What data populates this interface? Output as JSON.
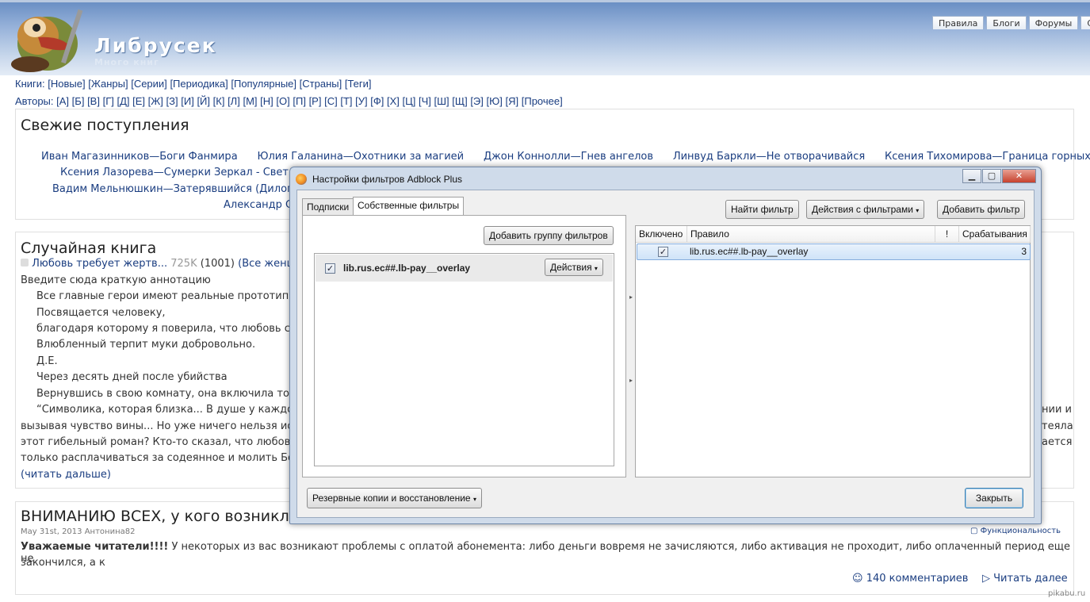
{
  "site": {
    "title": "Либрусек",
    "subtitle": "Много книг",
    "top_tabs": [
      "Правила",
      "Блоги",
      "Форумы",
      "С"
    ]
  },
  "nav": {
    "books_label": "Книги:",
    "books_links": [
      "[Новые]",
      "[Жанры]",
      "[Серии]",
      "[Периодика]",
      "[Популярные]",
      "[Страны]",
      "[Теги]"
    ],
    "authors_label": "Авторы:",
    "authors_links": [
      "[А]",
      "[Б]",
      "[В]",
      "[Г]",
      "[Д]",
      "[Е]",
      "[Ж]",
      "[З]",
      "[И]",
      "[Й]",
      "[К]",
      "[Л]",
      "[М]",
      "[Н]",
      "[О]",
      "[П]",
      "[Р]",
      "[С]",
      "[Т]",
      "[У]",
      "[Ф]",
      "[Х]",
      "[Ц]",
      "[Ч]",
      "[Ш]",
      "[Щ]",
      "[Э]",
      "[Ю]",
      "[Я]",
      "[Прочее]"
    ]
  },
  "fresh": {
    "title": "Свежие поступления",
    "row1": [
      "Иван Магазинников—Боги Фанмира",
      "Юлия Галанина—Охотники за магией",
      "Джон Коннолли—Гнев ангелов",
      "Линвуд Баркли—Не отворачивайся",
      "Ксения Тихомирова—Граница горных вил"
    ],
    "row2": "Ксения Лазорева—Сумерки Зеркал - Свет Зе",
    "row3": "Вадим Мельнюшкин—Затерявшийся (Дилогия)",
    "row4": "Александр С"
  },
  "random": {
    "title": "Случайная книга",
    "book_title": "Любовь требует жертв...",
    "size": "725K",
    "count": "(1001)",
    "genre": "(Все женщ",
    "annotation_label": "Введите сюда краткую аннотацию",
    "lines": [
      "Все главные герои имеют реальные прототипы, а",
      "Посвящается человеку,",
      "благодаря которому я поверила, что любовь сущ",
      "Влюбленный терпит муки добровольно.",
      "Д.Е.",
      "Через десять дней после убийства",
      "Вернувшись в свою комнату, она включила торш",
      "“Символика, которая близка... В душе у каждог"
    ],
    "line9_left": "вызывая чувство вины... Но уже ничего нельзя испр",
    "line10_left": "этот гибельный роман? Кто-то сказал, что любовь",
    "line11_left": "только расплачиваться за содеянное и молить Бога,",
    "line8_right": "нии и",
    "line9_right": "теяла",
    "line10_right": "ается",
    "read_more": "(читать дальше)"
  },
  "notice": {
    "title": "ВНИМАНИЮ ВСЕХ, у кого возникл",
    "date": "May 31st, 2013",
    "author": "Антонина82",
    "tag": "Функциональность",
    "bold_lead": "Уважаемые читатели!!!!",
    "text": " У некоторых из вас возникают проблемы с оплатой абонемента: либо деньги вовремя не зачисляются, либо активация не проходит, либо оплаченный период еще не",
    "text2": "закончился, а к",
    "comments": "140 комментариев",
    "read_more": "Читать далее"
  },
  "watermark": "pikabu.ru",
  "dialog": {
    "title": "Настройки фильтров Adblock Plus",
    "tabs": [
      "Подписки",
      "Собственные фильтры"
    ],
    "add_group_button": "Добавить группу фильтров",
    "group": {
      "name": "lib.rus.ec##.lb-pay__overlay",
      "enabled": true,
      "actions_button": "Действия"
    },
    "find_filter_button": "Найти фильтр",
    "filter_actions_button": "Действия с фильтрами",
    "add_filter_button": "Добавить фильтр",
    "columns": [
      "Включено",
      "Правило",
      "!",
      "Срабатывания"
    ],
    "rows": [
      {
        "enabled": true,
        "rule": "lib.rus.ec##.lb-pay__overlay",
        "hits": "3"
      }
    ],
    "backup_button": "Резервные копии и восстановление",
    "close_button": "Закрыть"
  }
}
